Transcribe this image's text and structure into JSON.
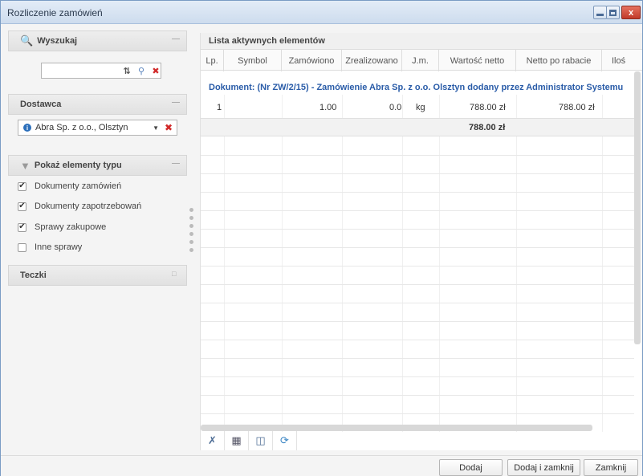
{
  "window": {
    "title": "Rozliczenie zamówień",
    "close_label": "x"
  },
  "left": {
    "search": {
      "title": "Wyszukaj",
      "value": "",
      "placeholder": ""
    },
    "supplier": {
      "title": "Dostawca",
      "value": "Abra Sp. z o.o., Olsztyn"
    },
    "types": {
      "title": "Pokaż elementy typu",
      "items": [
        {
          "label": "Dokumenty zamówień",
          "checked": true
        },
        {
          "label": "Dokumenty zapotrzebowań",
          "checked": true
        },
        {
          "label": "Sprawy zakupowe",
          "checked": true
        },
        {
          "label": "Inne sprawy",
          "checked": false
        }
      ]
    },
    "folders": {
      "title": "Teczki"
    }
  },
  "grid": {
    "caption": "Lista aktywnych elementów",
    "columns": [
      "Lp.",
      "Symbol",
      "Zamówiono",
      "Zrealizowano",
      "J.m.",
      "Wartość netto",
      "Netto po rabacie",
      "Iloś"
    ],
    "document_label": "Dokument: (Nr ZW/2/15) - Zamówienie Abra Sp. z o.o. Olsztyn dodany przez Administrator Systemu",
    "rows": [
      {
        "lp": "1",
        "symbol": "",
        "ordered": "1.00",
        "realized": "0.0",
        "unit": "kg",
        "net": "788.00 zł",
        "net_discount": "788.00 zł"
      }
    ],
    "summary": {
      "net": "788.00 zł"
    }
  },
  "footer": {
    "add": "Dodaj",
    "add_close": "Dodaj i zamknij",
    "close": "Zamknij"
  },
  "colors": {
    "accent_blue": "#2a5ca8",
    "delete_red": "#d12a2a"
  }
}
